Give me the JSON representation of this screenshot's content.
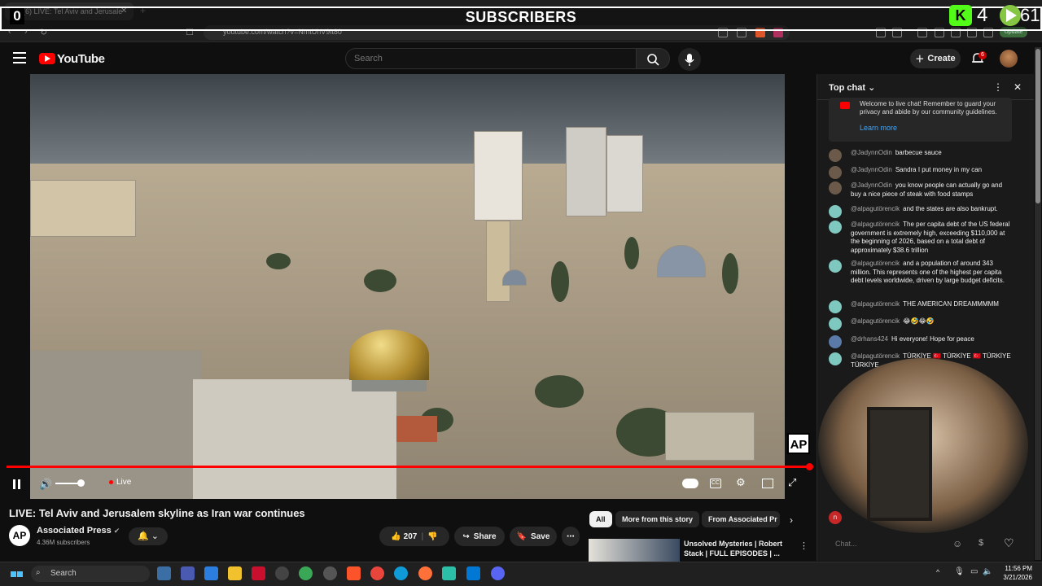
{
  "browser": {
    "tab_title": "(6) LIVE: Tel Aviv and Jerusale",
    "url": "youtube.com/watch?v=NmtUhV9lt80",
    "update_label": "Update"
  },
  "overlay": {
    "title": "SUBSCRIBERS",
    "count": "0",
    "kick_count": "4",
    "rumble_count": "61"
  },
  "header": {
    "logo_text": "YouTube",
    "search_placeholder": "Search",
    "create_label": "Create",
    "notifications": "6"
  },
  "player": {
    "live_label": "Live",
    "ap_logo": "AP",
    "progress": 1.0
  },
  "video": {
    "title": "LIVE: Tel Aviv and Jerusalem skyline as Iran war continues",
    "channel": "Associated Press",
    "subscribers": "4.36M subscribers",
    "likes": "207",
    "share_label": "Share",
    "save_label": "Save"
  },
  "chips": [
    "All",
    "More from this story",
    "From Associated Pr"
  ],
  "recommendation": {
    "title": "Unsolved Mysteries | Robert Stack | FULL EPISODES | ..."
  },
  "chat": {
    "title": "Top chat",
    "welcome": "Welcome to live chat! Remember to guard your privacy and abide by our community guidelines.",
    "learn_more": "Learn more",
    "input_placeholder": "Chat...",
    "messages": [
      {
        "author": "@JadynnOdin",
        "text": "barbecue sauce"
      },
      {
        "author": "@JadynnOdin",
        "text": "Sandra I put money in my can"
      },
      {
        "author": "@JadynnOdin",
        "text": "you know people can actually go and buy a nice piece of steak with food stamps"
      },
      {
        "author": "@alpagutörencik",
        "text": "and the states are also bankrupt."
      },
      {
        "author": "@alpagutörencik",
        "text": "The per capita debt of the US federal government is extremely high, exceeding $110,000 at the beginning of 2026, based on a total debt of approximately $38.6 trillion"
      },
      {
        "author": "@alpagutörencik",
        "text": "and a population of around 343 million. This represents one of the highest per capita debt levels worldwide, driven by large budget deficits."
      },
      {
        "author": "@alpagutörencik",
        "text": "THE AMERICAN DREAMMMMM"
      },
      {
        "author": "@alpagutörencik",
        "text": "😂🤣😂🤣"
      },
      {
        "author": "@drhans424",
        "text": "Hi everyone! Hope for peace"
      },
      {
        "author": "@alpagutörencik",
        "text": "TÜRKİYE 🇹🇷 TÜRKİYE 🇹🇷 TÜRKİYE TÜRKİYE"
      }
    ]
  },
  "taskbar": {
    "search_label": "Search",
    "time": "11:56 PM",
    "date": "3/21/2026"
  }
}
